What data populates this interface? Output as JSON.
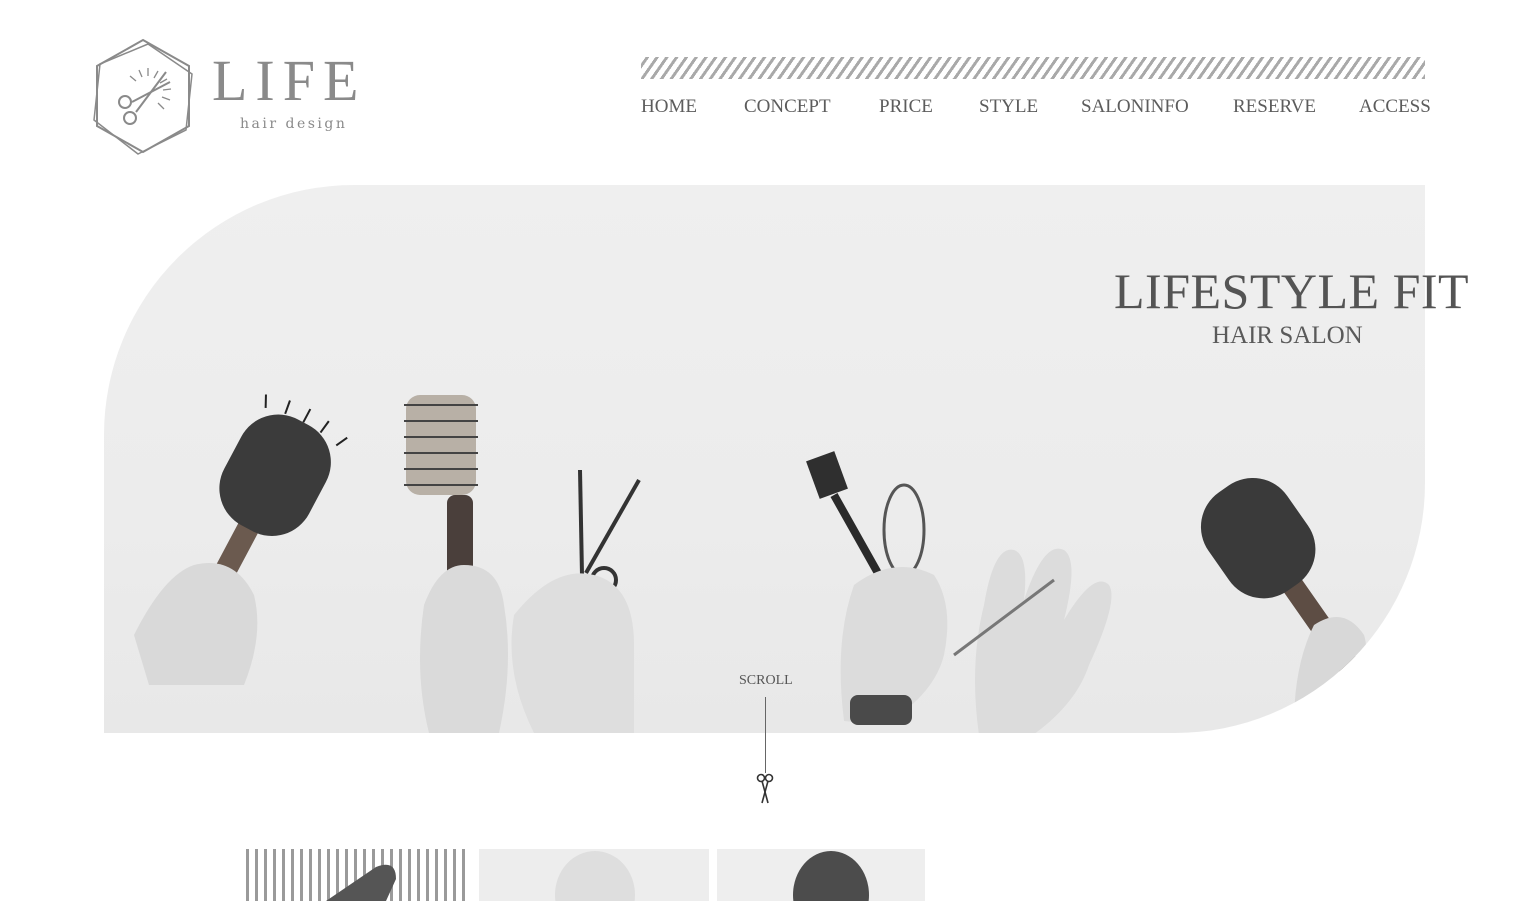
{
  "brand": {
    "name": "LIFE",
    "tagline": "hair design"
  },
  "nav": {
    "items": [
      {
        "label": "HOME"
      },
      {
        "label": "CONCEPT"
      },
      {
        "label": "PRICE"
      },
      {
        "label": "STYLE"
      },
      {
        "label": "SALONINFO"
      },
      {
        "label": "RESERVE"
      },
      {
        "label": "ACCESS"
      }
    ]
  },
  "hero": {
    "title": "LIFESTYLE FIT",
    "subtitle": "HAIR SALON",
    "image_subject": "hands holding hairbrushes, scissors, tint brush and whisk"
  },
  "scroll": {
    "label": "SCROLL",
    "icon": "scissors-icon"
  },
  "thumbnails": [
    {
      "name": "thumb-striped-comb"
    },
    {
      "name": "thumb-light-head"
    },
    {
      "name": "thumb-dark-head"
    }
  ],
  "colors": {
    "text": "#555555",
    "logo": "#8a8a8a",
    "hero_bg": "#ececec",
    "stripe": "#a9a9a9"
  }
}
